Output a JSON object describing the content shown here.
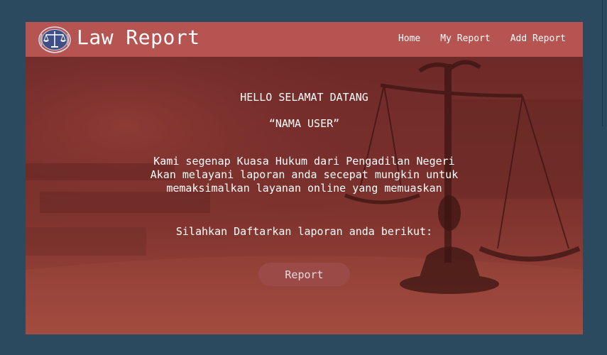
{
  "header": {
    "brand_title": "Law Report",
    "nav_items": [
      "Home",
      "My Report",
      "Add Report"
    ]
  },
  "hero": {
    "greeting": "HELLO SELAMAT DATANG",
    "user_name": "“NAMA USER”",
    "message_lines": [
      "Kami segenap Kuasa Hukum dari Pengadilan Negeri",
      "Akan melayani laporan anda secepat mungkin untuk",
      "memaksimalkan layanan online yang memuaskan"
    ],
    "prompt": "Silahkan Daftarkan laporan anda berikut:",
    "button_label": "Report"
  },
  "colors": {
    "page_bg": "#2c4a5f",
    "navbar_bg": "#b65452",
    "hero_tint": "#7a302c",
    "button_bg": "#9b4a48"
  },
  "icons": {
    "logo": "scales-of-justice-icon"
  }
}
